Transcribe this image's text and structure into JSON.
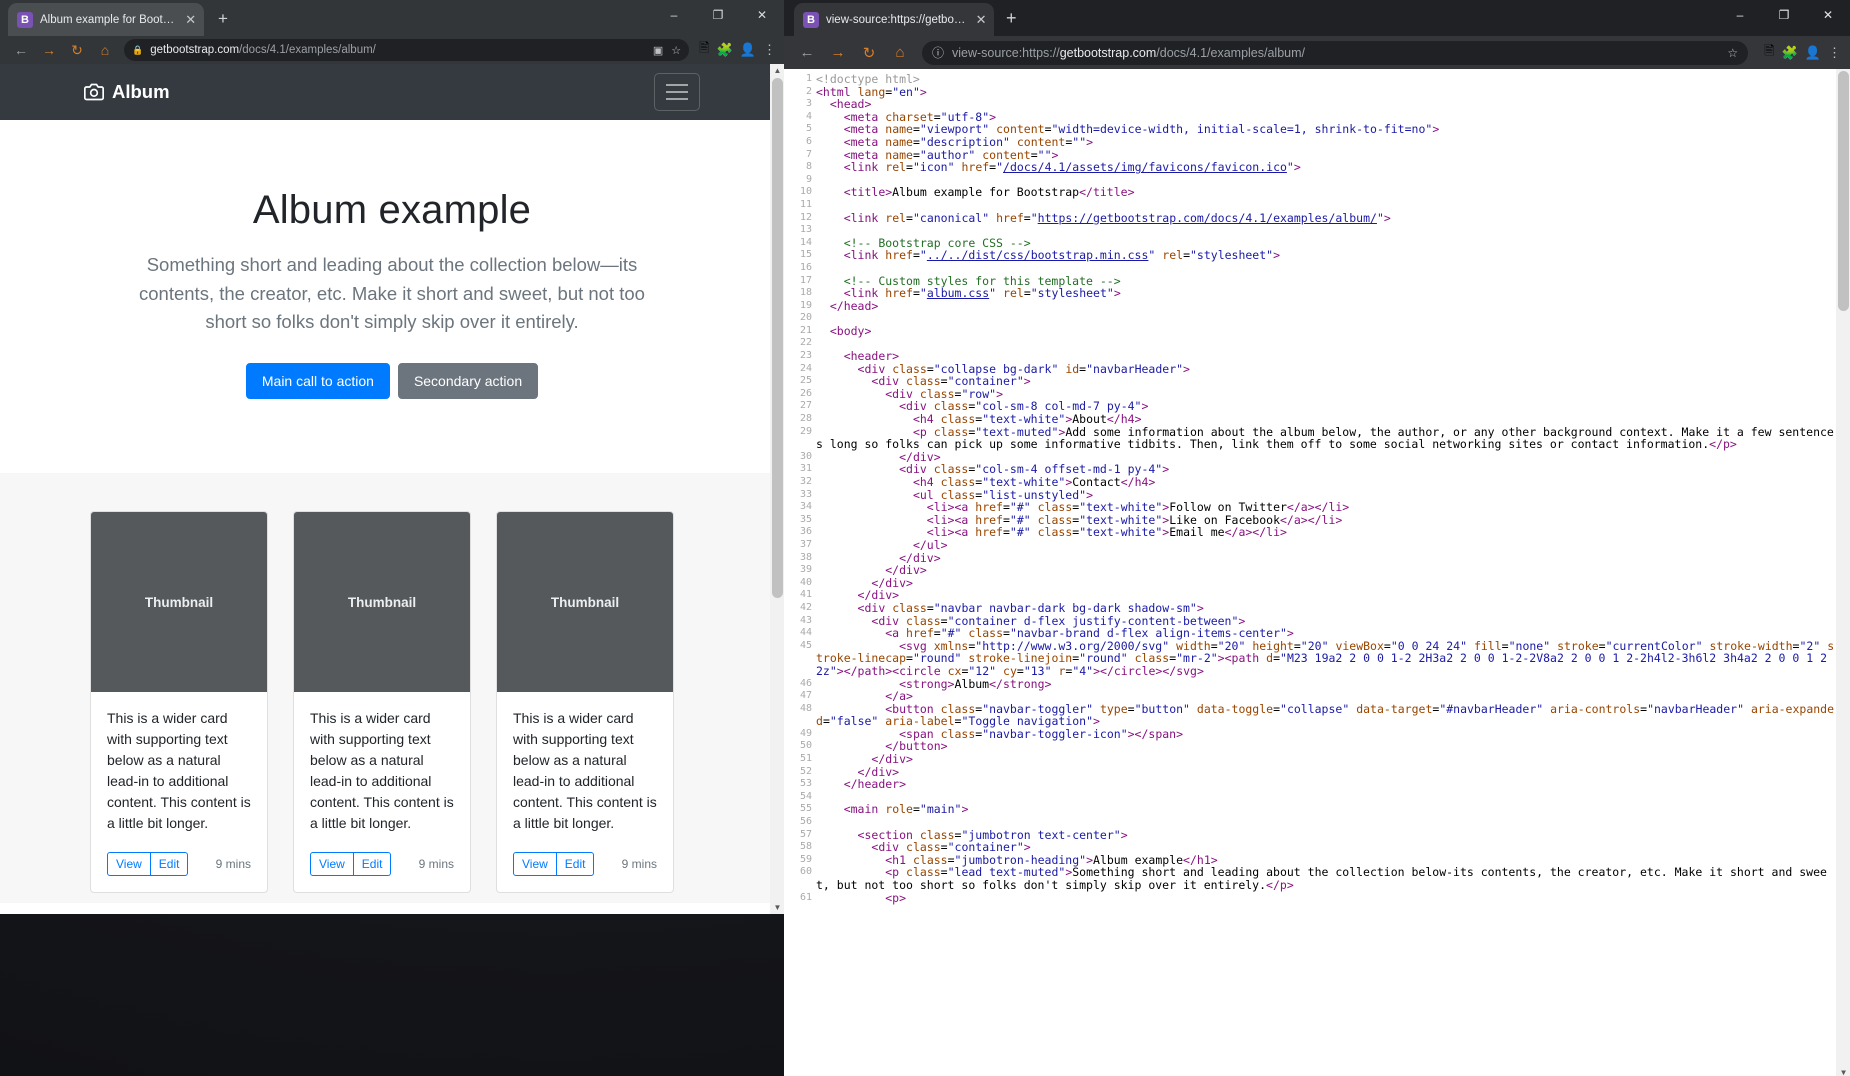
{
  "window_left": {
    "tab": {
      "title": "Album example for Bootstrap",
      "favicon_letter": "B",
      "close_icon": "close-icon"
    },
    "new_tab_label": "+",
    "window_controls": {
      "minimize": "–",
      "maximize": "❐",
      "close": "✕"
    },
    "toolbar": {
      "back": "←",
      "forward": "→",
      "reload": "↻",
      "home": "⌂",
      "lock_icon": "🔒",
      "url_domain": "getbootstrap.com",
      "url_path": "/docs/4.1/examples/album/",
      "translate_icon": "translate-icon",
      "bookmark_icon": "☆"
    },
    "page": {
      "navbar_brand": "Album",
      "toggler_label": "Toggle navigation",
      "jumbotron": {
        "heading": "Album example",
        "lead": "Something short and leading about the collection below—its contents, the creator, etc. Make it short and sweet, but not too short so folks don't simply skip over it entirely.",
        "primary_button": "Main call to action",
        "secondary_button": "Secondary action"
      },
      "cards": [
        {
          "thumb_label": "Thumbnail",
          "text": "This is a wider card with supporting text below as a natural lead-in to additional content. This content is a little bit longer.",
          "view": "View",
          "edit": "Edit",
          "mins": "9 mins"
        },
        {
          "thumb_label": "Thumbnail",
          "text": "This is a wider card with supporting text below as a natural lead-in to additional content. This content is a little bit longer.",
          "view": "View",
          "edit": "Edit",
          "mins": "9 mins"
        },
        {
          "thumb_label": "Thumbnail",
          "text": "This is a wider card with supporting text below as a natural lead-in to additional content. This content is a little bit longer.",
          "view": "View",
          "edit": "Edit",
          "mins": "9 mins"
        }
      ]
    }
  },
  "window_right": {
    "tab": {
      "title": "view-source:https://getbootstrap",
      "favicon_letter": "B",
      "close_icon": "close-icon"
    },
    "new_tab_label": "+",
    "window_controls": {
      "minimize": "–",
      "maximize": "❐",
      "close": "✕"
    },
    "toolbar": {
      "back": "←",
      "forward": "→",
      "reload": "↻",
      "home": "⌂",
      "info_icon": "ⓘ",
      "url_prefix": "view-source:https://",
      "url_domain": "getbootstrap.com",
      "url_path": "/docs/4.1/examples/album/",
      "bookmark_icon": "☆",
      "translate_icon": "translate-icon",
      "extension_icon": "extension-icon",
      "avatar_icon": "avatar-icon",
      "menu_icon": "⋮"
    },
    "source_lines": [
      {
        "n": 1,
        "html": "<span class=\"dc\">&lt;!doctype html&gt;</span>"
      },
      {
        "n": 2,
        "html": "<span class=\"tg\">&lt;html</span> <span class=\"at\">lang</span>=<span class=\"vl\">\"en\"</span><span class=\"tg\">&gt;</span>"
      },
      {
        "n": 3,
        "html": "  <span class=\"tg\">&lt;head&gt;</span>"
      },
      {
        "n": 4,
        "html": "    <span class=\"tg\">&lt;meta</span> <span class=\"at\">charset</span>=<span class=\"vl\">\"utf-8\"</span><span class=\"tg\">&gt;</span>"
      },
      {
        "n": 5,
        "html": "    <span class=\"tg\">&lt;meta</span> <span class=\"at\">name</span>=<span class=\"vl\">\"viewport\"</span> <span class=\"at\">content</span>=<span class=\"vl\">\"width=device-width, initial-scale=1, shrink-to-fit=no\"</span><span class=\"tg\">&gt;</span>"
      },
      {
        "n": 6,
        "html": "    <span class=\"tg\">&lt;meta</span> <span class=\"at\">name</span>=<span class=\"vl\">\"description\"</span> <span class=\"at\">content</span>=<span class=\"vl\">\"\"</span><span class=\"tg\">&gt;</span>"
      },
      {
        "n": 7,
        "html": "    <span class=\"tg\">&lt;meta</span> <span class=\"at\">name</span>=<span class=\"vl\">\"author\"</span> <span class=\"at\">content</span>=<span class=\"vl\">\"\"</span><span class=\"tg\">&gt;</span>"
      },
      {
        "n": 8,
        "html": "    <span class=\"tg\">&lt;link</span> <span class=\"at\">rel</span>=<span class=\"vl\">\"icon\"</span> <span class=\"at\">href</span>=<span class=\"vl\">\"</span><span class=\"lk\">/docs/4.1/assets/img/favicons/favicon.ico</span><span class=\"vl\">\"</span><span class=\"tg\">&gt;</span>"
      },
      {
        "n": 9,
        "html": ""
      },
      {
        "n": 10,
        "html": "    <span class=\"tg\">&lt;title&gt;</span>Album example for Bootstrap<span class=\"tg\">&lt;/title&gt;</span>"
      },
      {
        "n": 11,
        "html": ""
      },
      {
        "n": 12,
        "html": "    <span class=\"tg\">&lt;link</span> <span class=\"at\">rel</span>=<span class=\"vl\">\"canonical\"</span> <span class=\"at\">href</span>=<span class=\"vl\">\"</span><span class=\"lk\">https://getbootstrap.com/docs/4.1/examples/album/</span><span class=\"vl\">\"</span><span class=\"tg\">&gt;</span>"
      },
      {
        "n": 13,
        "html": ""
      },
      {
        "n": 14,
        "html": "    <span class=\"cm\">&lt;!-- Bootstrap core CSS --&gt;</span>"
      },
      {
        "n": 15,
        "html": "    <span class=\"tg\">&lt;link</span> <span class=\"at\">href</span>=<span class=\"vl\">\"</span><span class=\"lk\">../../dist/css/bootstrap.min.css</span><span class=\"vl\">\"</span> <span class=\"at\">rel</span>=<span class=\"vl\">\"stylesheet\"</span><span class=\"tg\">&gt;</span>"
      },
      {
        "n": 16,
        "html": ""
      },
      {
        "n": 17,
        "html": "    <span class=\"cm\">&lt;!-- Custom styles for this template --&gt;</span>"
      },
      {
        "n": 18,
        "html": "    <span class=\"tg\">&lt;link</span> <span class=\"at\">href</span>=<span class=\"vl\">\"</span><span class=\"lk\">album.css</span><span class=\"vl\">\"</span> <span class=\"at\">rel</span>=<span class=\"vl\">\"stylesheet\"</span><span class=\"tg\">&gt;</span>"
      },
      {
        "n": 19,
        "html": "  <span class=\"tg\">&lt;/head&gt;</span>"
      },
      {
        "n": 20,
        "html": ""
      },
      {
        "n": 21,
        "html": "  <span class=\"tg\">&lt;body&gt;</span>"
      },
      {
        "n": 22,
        "html": ""
      },
      {
        "n": 23,
        "html": "    <span class=\"tg\">&lt;header&gt;</span>"
      },
      {
        "n": 24,
        "html": "      <span class=\"tg\">&lt;div</span> <span class=\"at\">class</span>=<span class=\"vl\">\"collapse bg-dark\"</span> <span class=\"at\">id</span>=<span class=\"vl\">\"navbarHeader\"</span><span class=\"tg\">&gt;</span>"
      },
      {
        "n": 25,
        "html": "        <span class=\"tg\">&lt;div</span> <span class=\"at\">class</span>=<span class=\"vl\">\"container\"</span><span class=\"tg\">&gt;</span>"
      },
      {
        "n": 26,
        "html": "          <span class=\"tg\">&lt;div</span> <span class=\"at\">class</span>=<span class=\"vl\">\"row\"</span><span class=\"tg\">&gt;</span>"
      },
      {
        "n": 27,
        "html": "            <span class=\"tg\">&lt;div</span> <span class=\"at\">class</span>=<span class=\"vl\">\"col-sm-8 col-md-7 py-4\"</span><span class=\"tg\">&gt;</span>"
      },
      {
        "n": 28,
        "html": "              <span class=\"tg\">&lt;h4</span> <span class=\"at\">class</span>=<span class=\"vl\">\"text-white\"</span><span class=\"tg\">&gt;</span>About<span class=\"tg\">&lt;/h4&gt;</span>"
      },
      {
        "n": 29,
        "html": "              <span class=\"tg\">&lt;p</span> <span class=\"at\">class</span>=<span class=\"vl\">\"text-muted\"</span><span class=\"tg\">&gt;</span>Add some information about the album below, the author, or any other background context. Make it a few sentences long so folks can pick up some informative tidbits. Then, link them off to some social networking sites or contact information.<span class=\"tg\">&lt;/p&gt;</span>"
      },
      {
        "n": 30,
        "html": "            <span class=\"tg\">&lt;/div&gt;</span>"
      },
      {
        "n": 31,
        "html": "            <span class=\"tg\">&lt;div</span> <span class=\"at\">class</span>=<span class=\"vl\">\"col-sm-4 offset-md-1 py-4\"</span><span class=\"tg\">&gt;</span>"
      },
      {
        "n": 32,
        "html": "              <span class=\"tg\">&lt;h4</span> <span class=\"at\">class</span>=<span class=\"vl\">\"text-white\"</span><span class=\"tg\">&gt;</span>Contact<span class=\"tg\">&lt;/h4&gt;</span>"
      },
      {
        "n": 33,
        "html": "              <span class=\"tg\">&lt;ul</span> <span class=\"at\">class</span>=<span class=\"vl\">\"list-unstyled\"</span><span class=\"tg\">&gt;</span>"
      },
      {
        "n": 34,
        "html": "                <span class=\"tg\">&lt;li&gt;&lt;a</span> <span class=\"at\">href</span>=<span class=\"vl\">\"#\"</span> <span class=\"at\">class</span>=<span class=\"vl\">\"text-white\"</span><span class=\"tg\">&gt;</span>Follow on Twitter<span class=\"tg\">&lt;/a&gt;&lt;/li&gt;</span>"
      },
      {
        "n": 35,
        "html": "                <span class=\"tg\">&lt;li&gt;&lt;a</span> <span class=\"at\">href</span>=<span class=\"vl\">\"#\"</span> <span class=\"at\">class</span>=<span class=\"vl\">\"text-white\"</span><span class=\"tg\">&gt;</span>Like on Facebook<span class=\"tg\">&lt;/a&gt;&lt;/li&gt;</span>"
      },
      {
        "n": 36,
        "html": "                <span class=\"tg\">&lt;li&gt;&lt;a</span> <span class=\"at\">href</span>=<span class=\"vl\">\"#\"</span> <span class=\"at\">class</span>=<span class=\"vl\">\"text-white\"</span><span class=\"tg\">&gt;</span>Email me<span class=\"tg\">&lt;/a&gt;&lt;/li&gt;</span>"
      },
      {
        "n": 37,
        "html": "              <span class=\"tg\">&lt;/ul&gt;</span>"
      },
      {
        "n": 38,
        "html": "            <span class=\"tg\">&lt;/div&gt;</span>"
      },
      {
        "n": 39,
        "html": "          <span class=\"tg\">&lt;/div&gt;</span>"
      },
      {
        "n": 40,
        "html": "        <span class=\"tg\">&lt;/div&gt;</span>"
      },
      {
        "n": 41,
        "html": "      <span class=\"tg\">&lt;/div&gt;</span>"
      },
      {
        "n": 42,
        "html": "      <span class=\"tg\">&lt;div</span> <span class=\"at\">class</span>=<span class=\"vl\">\"navbar navbar-dark bg-dark shadow-sm\"</span><span class=\"tg\">&gt;</span>"
      },
      {
        "n": 43,
        "html": "        <span class=\"tg\">&lt;div</span> <span class=\"at\">class</span>=<span class=\"vl\">\"container d-flex justify-content-between\"</span><span class=\"tg\">&gt;</span>"
      },
      {
        "n": 44,
        "html": "          <span class=\"tg\">&lt;a</span> <span class=\"at\">href</span>=<span class=\"vl\">\"#\"</span> <span class=\"at\">class</span>=<span class=\"vl\">\"navbar-brand d-flex align-items-center\"</span><span class=\"tg\">&gt;</span>"
      },
      {
        "n": 45,
        "html": "            <span class=\"tg\">&lt;svg</span> <span class=\"at\">xmlns</span>=<span class=\"vl\">\"http://www.w3.org/2000/svg\"</span> <span class=\"at\">width</span>=<span class=\"vl\">\"20\"</span> <span class=\"at\">height</span>=<span class=\"vl\">\"20\"</span> <span class=\"at\">viewBox</span>=<span class=\"vl\">\"0 0 24 24\"</span> <span class=\"at\">fill</span>=<span class=\"vl\">\"none\"</span> <span class=\"at\">stroke</span>=<span class=\"vl\">\"currentColor\"</span> <span class=\"at\">stroke-width</span>=<span class=\"vl\">\"2\"</span> <span class=\"at\">stroke-linecap</span>=<span class=\"vl\">\"round\"</span> <span class=\"at\">stroke-linejoin</span>=<span class=\"vl\">\"round\"</span> <span class=\"at\">class</span>=<span class=\"vl\">\"mr-2\"</span><span class=\"tg\">&gt;&lt;path</span> <span class=\"at\">d</span>=<span class=\"vl\">\"M23 19a2 2 0 0 1-2 2H3a2 2 0 0 1-2-2V8a2 2 0 0 1 2-2h4l2-3h6l2 3h4a2 2 0 0 1 2 2z\"</span><span class=\"tg\">&gt;&lt;/path&gt;&lt;circle</span> <span class=\"at\">cx</span>=<span class=\"vl\">\"12\"</span> <span class=\"at\">cy</span>=<span class=\"vl\">\"13\"</span> <span class=\"at\">r</span>=<span class=\"vl\">\"4\"</span><span class=\"tg\">&gt;&lt;/circle&gt;&lt;/svg&gt;</span>"
      },
      {
        "n": 46,
        "html": "            <span class=\"tg\">&lt;strong&gt;</span>Album<span class=\"tg\">&lt;/strong&gt;</span>"
      },
      {
        "n": 47,
        "html": "          <span class=\"tg\">&lt;/a&gt;</span>"
      },
      {
        "n": 48,
        "html": "          <span class=\"tg\">&lt;button</span> <span class=\"at\">class</span>=<span class=\"vl\">\"navbar-toggler\"</span> <span class=\"at\">type</span>=<span class=\"vl\">\"button\"</span> <span class=\"at\">data-toggle</span>=<span class=\"vl\">\"collapse\"</span> <span class=\"at\">data-target</span>=<span class=\"vl\">\"#navbarHeader\"</span> <span class=\"at\">aria-controls</span>=<span class=\"vl\">\"navbarHeader\"</span> <span class=\"at\">aria-expanded</span>=<span class=\"vl\">\"false\"</span> <span class=\"at\">aria-label</span>=<span class=\"vl\">\"Toggle navigation\"</span><span class=\"tg\">&gt;</span>"
      },
      {
        "n": 49,
        "html": "            <span class=\"tg\">&lt;span</span> <span class=\"at\">class</span>=<span class=\"vl\">\"navbar-toggler-icon\"</span><span class=\"tg\">&gt;&lt;/span&gt;</span>"
      },
      {
        "n": 50,
        "html": "          <span class=\"tg\">&lt;/button&gt;</span>"
      },
      {
        "n": 51,
        "html": "        <span class=\"tg\">&lt;/div&gt;</span>"
      },
      {
        "n": 52,
        "html": "      <span class=\"tg\">&lt;/div&gt;</span>"
      },
      {
        "n": 53,
        "html": "    <span class=\"tg\">&lt;/header&gt;</span>"
      },
      {
        "n": 54,
        "html": ""
      },
      {
        "n": 55,
        "html": "    <span class=\"tg\">&lt;main</span> <span class=\"at\">role</span>=<span class=\"vl\">\"main\"</span><span class=\"tg\">&gt;</span>"
      },
      {
        "n": 56,
        "html": ""
      },
      {
        "n": 57,
        "html": "      <span class=\"tg\">&lt;section</span> <span class=\"at\">class</span>=<span class=\"vl\">\"jumbotron text-center\"</span><span class=\"tg\">&gt;</span>"
      },
      {
        "n": 58,
        "html": "        <span class=\"tg\">&lt;div</span> <span class=\"at\">class</span>=<span class=\"vl\">\"container\"</span><span class=\"tg\">&gt;</span>"
      },
      {
        "n": 59,
        "html": "          <span class=\"tg\">&lt;h1</span> <span class=\"at\">class</span>=<span class=\"vl\">\"jumbotron-heading\"</span><span class=\"tg\">&gt;</span>Album example<span class=\"tg\">&lt;/h1&gt;</span>"
      },
      {
        "n": 60,
        "html": "          <span class=\"tg\">&lt;p</span> <span class=\"at\">class</span>=<span class=\"vl\">\"lead text-muted\"</span><span class=\"tg\">&gt;</span>Something short and leading about the collection below-its contents, the creator, etc. Make it short and sweet, but not too short so folks don't simply skip over it entirely.<span class=\"tg\">&lt;/p&gt;</span>"
      },
      {
        "n": 61,
        "html": "          <span class=\"tg\">&lt;p&gt;</span>"
      }
    ]
  },
  "colors": {
    "accent_primary": "#007bff",
    "accent_secondary": "#6c757d",
    "dark_navbar": "#343a40",
    "thumb_gray": "#55595c",
    "tag_purple": "#881280",
    "attr_orange": "#994500",
    "value_blue": "#1a1aa6",
    "comment_green": "#236e25"
  }
}
